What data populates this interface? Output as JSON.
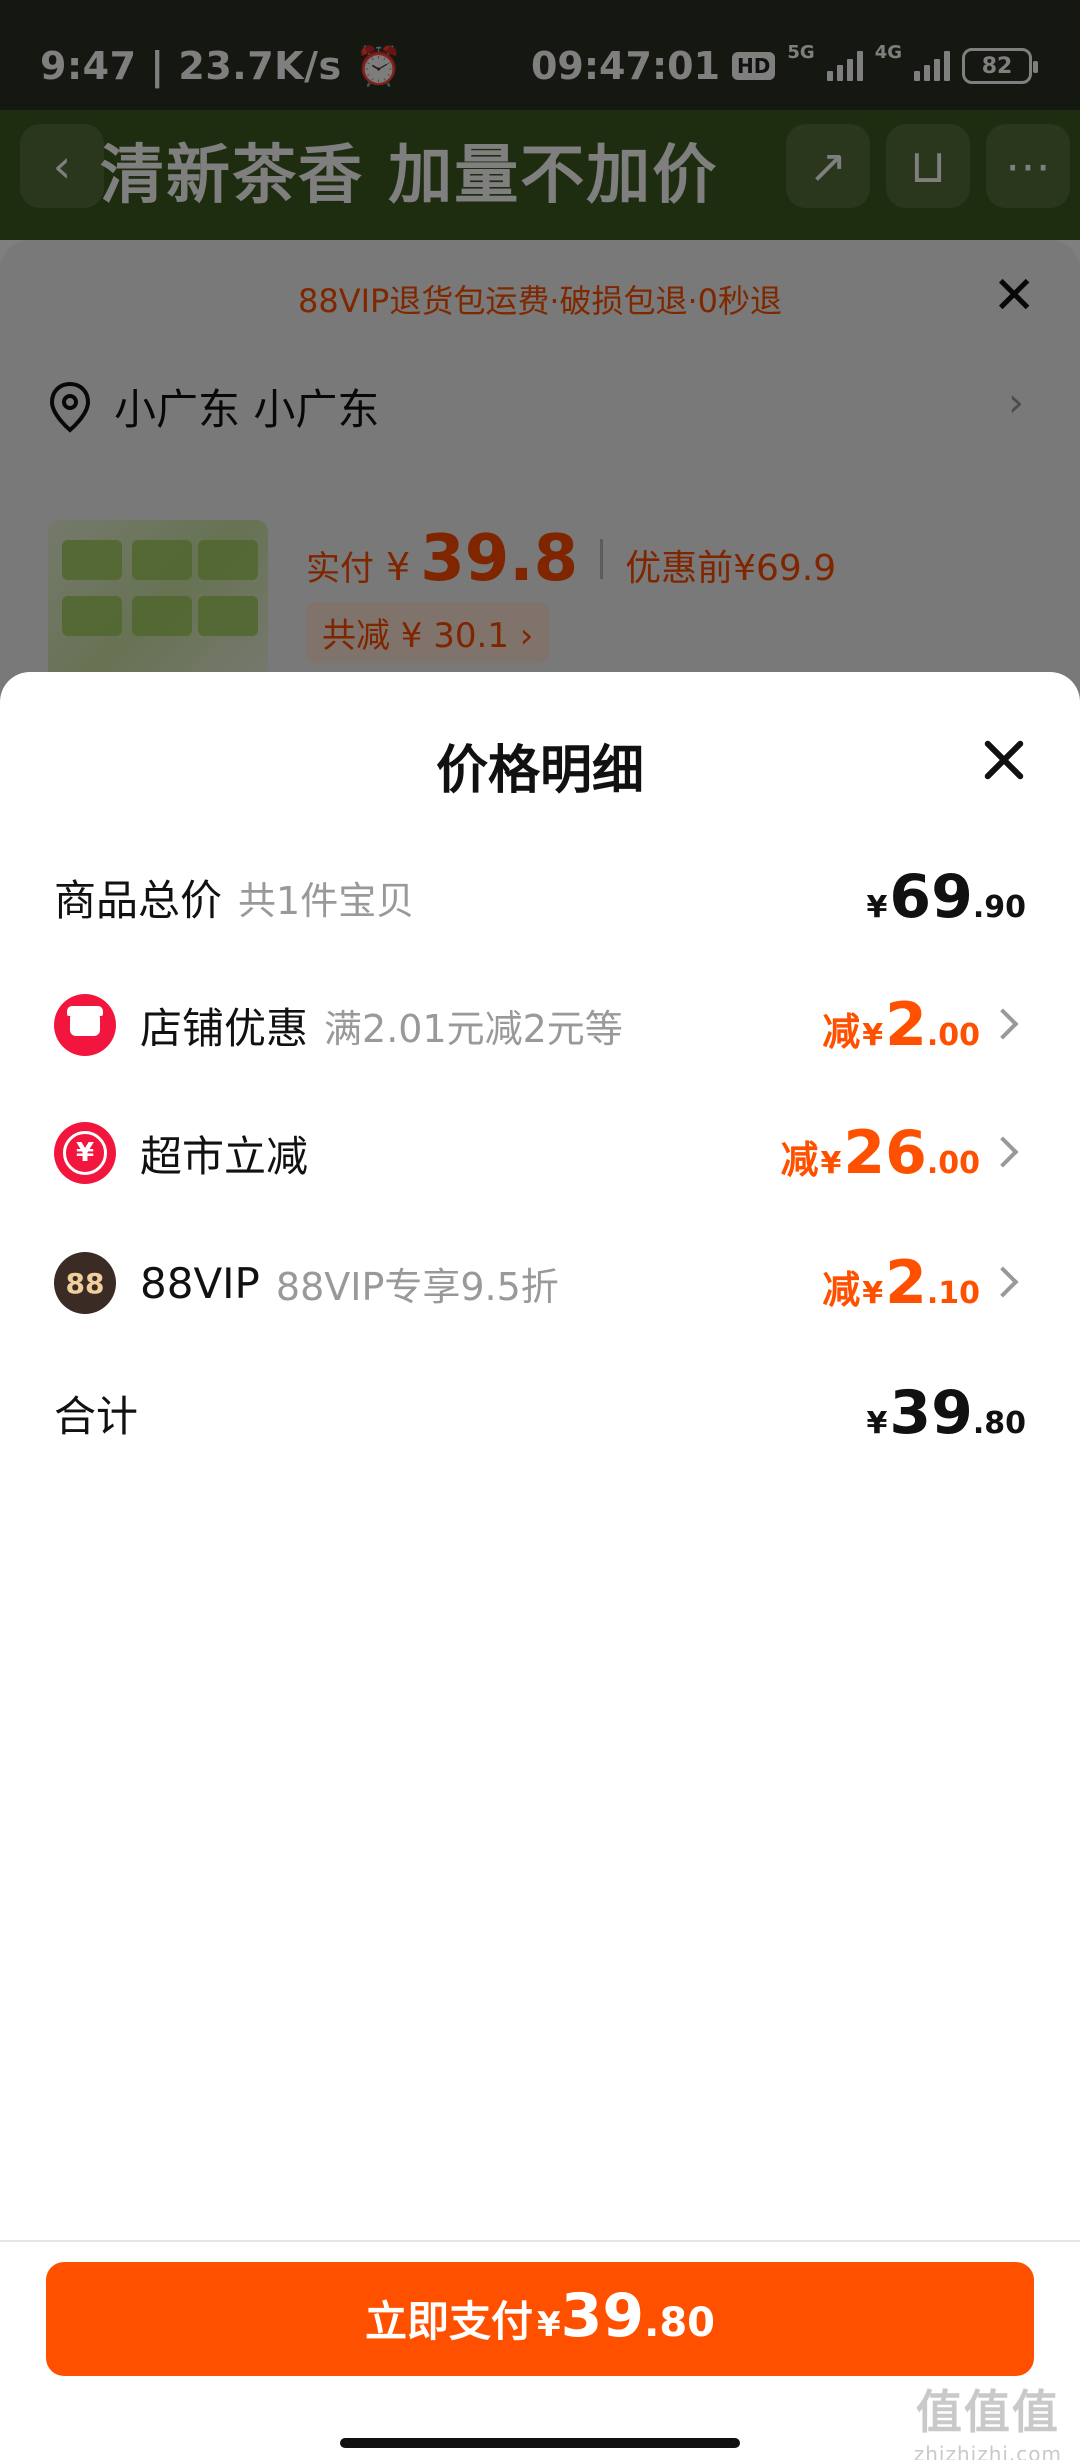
{
  "status_bar": {
    "time": "9:47",
    "speed": "23.7K/s",
    "clock": "09:47:01",
    "hd": "HD",
    "net_5g": "5G",
    "net_4g": "4G",
    "battery": "82"
  },
  "background": {
    "banner_text": "清新茶香 加量不加价",
    "notice": "88VIP退货包运费·破损包退·0秒退",
    "address": "小广东 小广东",
    "paid_label": "实付",
    "paid_yen": "¥",
    "paid_amount": "39.8",
    "before_label": "优惠前¥69.9",
    "saving_label": "共减 ¥ 30.1 ›"
  },
  "detail": {
    "title": "价格明细",
    "rows": [
      {
        "label": "商品总价",
        "sub": "共1件宝贝",
        "prefix": "",
        "yen": "¥",
        "int": "69",
        "dec": ".90"
      },
      {
        "label": "店铺优惠",
        "sub": "满2.01元减2元等",
        "prefix": "减",
        "yen": "¥",
        "int": "2",
        "dec": ".00"
      },
      {
        "label": "超市立减",
        "sub": "",
        "prefix": "减",
        "yen": "¥",
        "int": "26",
        "dec": ".00"
      },
      {
        "label": "88VIP",
        "sub": "88VIP专享9.5折",
        "prefix": "减",
        "yen": "¥",
        "int": "2",
        "dec": ".10"
      },
      {
        "label": "合计",
        "sub": "",
        "prefix": "",
        "yen": "¥",
        "int": "39",
        "dec": ".80"
      }
    ],
    "vip_icon_text": "88",
    "market_icon_text": "¥"
  },
  "pay_button": {
    "label": "立即支付",
    "yen": "¥",
    "int": "39",
    "dec": ".80"
  },
  "watermark": {
    "mark": "值值值",
    "site": "zhizhizhi.com"
  },
  "colors": {
    "accent": "#ff5000",
    "shop_icon": "#f2153e",
    "vip_icon": "#3a2c25"
  }
}
